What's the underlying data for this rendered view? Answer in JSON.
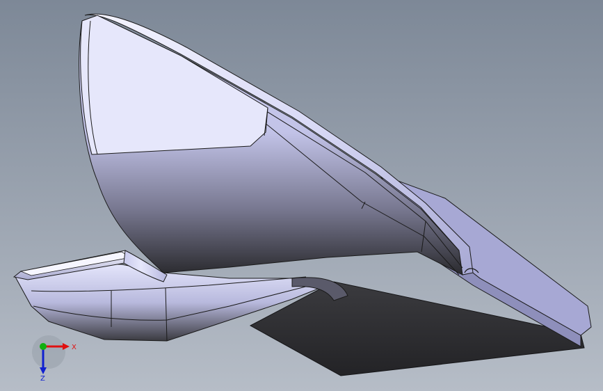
{
  "viewport": {
    "background_top": "#7d8897",
    "background_bottom": "#b4bcc6"
  },
  "model": {
    "surface_light": "#eceefa",
    "surface_mid": "#c9c9ec",
    "surface_shadow": "#2e2e31",
    "edge_color": "#1a1a1a"
  },
  "triad": {
    "x_label": "X",
    "z_label": "Z",
    "x_color": "#e01010",
    "y_color": "#10b010",
    "z_color": "#1020d0"
  }
}
